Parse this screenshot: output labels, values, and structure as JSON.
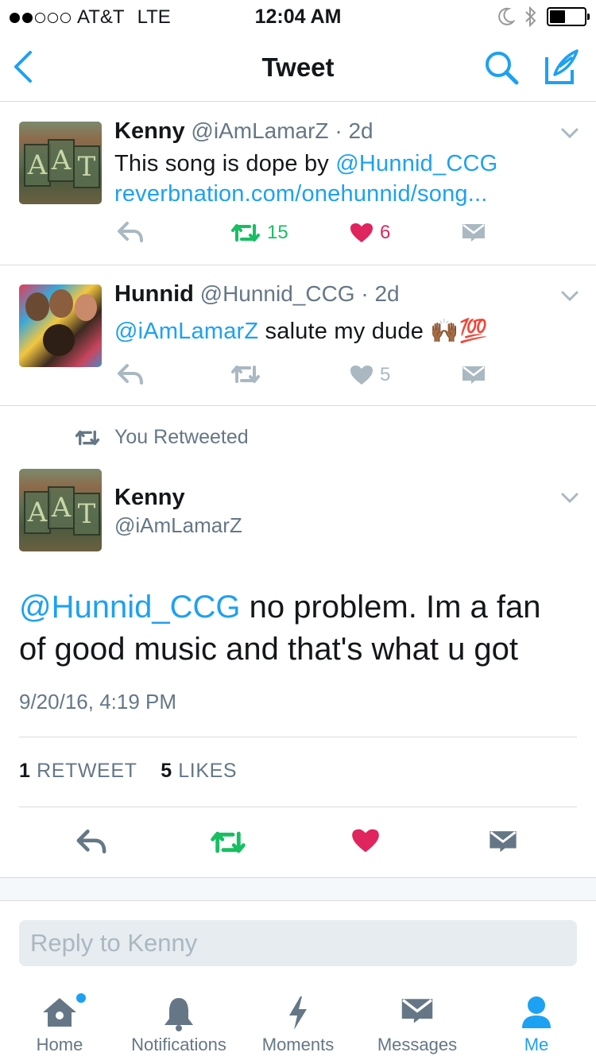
{
  "status_bar": {
    "carrier": "AT&T",
    "network": "LTE",
    "time": "12:04 AM",
    "signal_bars_filled": 2,
    "signal_bars_total": 5,
    "battery_level": 0.45
  },
  "nav": {
    "title": "Tweet",
    "back_icon": "chevron-left-icon",
    "search_icon": "search-icon",
    "compose_icon": "compose-icon"
  },
  "tweets": [
    {
      "name": "Kenny",
      "handle": "@iAmLamarZ",
      "separator": "·",
      "age": "2d",
      "text_before": "This song is dope by ",
      "mention": "@Hunnid_CCG",
      "link": "reverbnation.com/onehunnid/song...",
      "retweets": "15",
      "likes": "6",
      "retweeted": true,
      "liked": true
    },
    {
      "name": "Hunnid",
      "handle": "@Hunnid_CCG",
      "separator": "·",
      "age": "2d",
      "mention": "@iAmLamarZ",
      "text_after": " salute my dude ",
      "emoji": "🙌🏾💯",
      "retweets": "",
      "likes": "5",
      "retweeted": false,
      "liked": false
    }
  ],
  "retweeted_label": "You Retweeted",
  "main_tweet": {
    "name": "Kenny",
    "handle": "@iAmLamarZ",
    "mention": "@Hunnid_CCG",
    "text": " no problem. Im a fan of good music and that's what u got",
    "timestamp": "9/20/16, 4:19 PM",
    "retweet_count": "1",
    "retweet_label": "RETWEET",
    "like_count": "5",
    "like_label": "LIKES"
  },
  "reply": {
    "placeholder": "Reply to Kenny"
  },
  "tabs": [
    {
      "label": "Home",
      "icon": "home-icon"
    },
    {
      "label": "Notifications",
      "icon": "bell-icon"
    },
    {
      "label": "Moments",
      "icon": "lightning-icon"
    },
    {
      "label": "Messages",
      "icon": "envelope-icon"
    },
    {
      "label": "Me",
      "icon": "person-icon"
    }
  ],
  "colors": {
    "accent": "#1da1f2",
    "retweet_green": "#17bf63",
    "like_red": "#e0245e",
    "muted": "#aab8c2",
    "text_secondary": "#657786"
  }
}
